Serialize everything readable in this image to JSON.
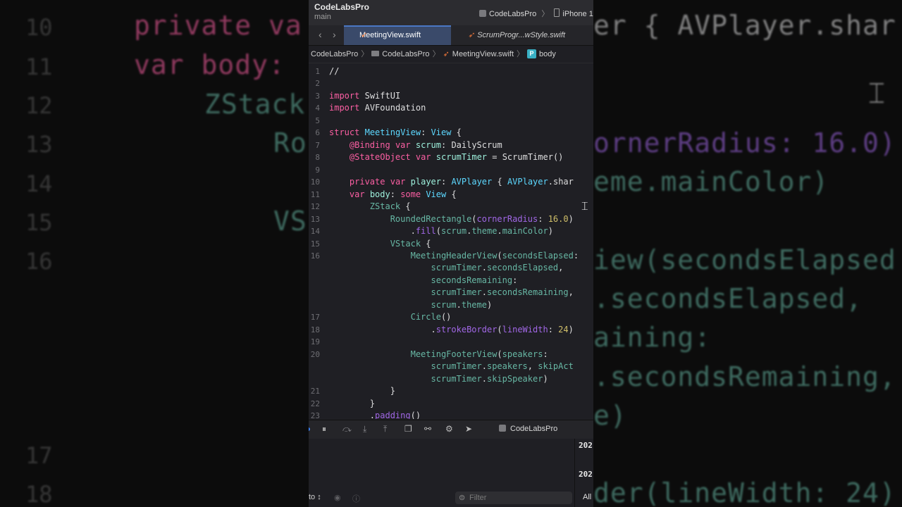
{
  "window": {
    "project": "CodeLabsPro",
    "branch": "main",
    "scheme_project": "CodeLabsPro",
    "scheme_device": "iPhone 1"
  },
  "tabs": [
    {
      "label": "MeetingView.swift",
      "active": true
    },
    {
      "label": "ScrumProgr...wStyle.swift",
      "active": false
    }
  ],
  "breadcrumb": [
    "CodeLabsPro",
    "CodeLabsPro",
    "MeetingView.swift",
    "body"
  ],
  "editor": {
    "lines": [
      {
        "n": "1",
        "text": "//"
      },
      {
        "n": "2",
        "text": ""
      },
      {
        "n": "3",
        "text": "import SwiftUI"
      },
      {
        "n": "4",
        "text": "import AVFoundation"
      },
      {
        "n": "5",
        "text": ""
      },
      {
        "n": "6",
        "text": "struct MeetingView: View {"
      },
      {
        "n": "7",
        "text": "    @Binding var scrum: DailyScrum"
      },
      {
        "n": "8",
        "text": "    @StateObject var scrumTimer = ScrumTimer()"
      },
      {
        "n": "9",
        "text": ""
      },
      {
        "n": "10",
        "text": "    private var player: AVPlayer { AVPlayer.shar"
      },
      {
        "n": "11",
        "text": "    var body: some View {"
      },
      {
        "n": "12",
        "text": "        ZStack {"
      },
      {
        "n": "13",
        "text": "            RoundedRectangle(cornerRadius: 16.0)"
      },
      {
        "n": "14",
        "text": "                .fill(scrum.theme.mainColor)"
      },
      {
        "n": "15",
        "text": "            VStack {"
      },
      {
        "n": "16",
        "text": "                MeetingHeaderView(secondsElapsed:"
      },
      {
        "n": "",
        "text": "                    scrumTimer.secondsElapsed,"
      },
      {
        "n": "",
        "text": "                    secondsRemaining:"
      },
      {
        "n": "",
        "text": "                    scrumTimer.secondsRemaining,"
      },
      {
        "n": "",
        "text": "                    scrum.theme)"
      },
      {
        "n": "17",
        "text": "                Circle()"
      },
      {
        "n": "18",
        "text": "                    .strokeBorder(lineWidth: 24)"
      },
      {
        "n": "19",
        "text": ""
      },
      {
        "n": "20",
        "text": "                MeetingFooterView(speakers:"
      },
      {
        "n": "",
        "text": "                    scrumTimer.speakers, skipAct:"
      },
      {
        "n": "",
        "text": "                    scrumTimer.skipSpeaker)"
      },
      {
        "n": "21",
        "text": "            }"
      },
      {
        "n": "22",
        "text": "        }"
      },
      {
        "n": "23",
        "text": "        .padding()"
      }
    ]
  },
  "debug": {
    "project": "CodeLabsPro",
    "log_lines": [
      "202",
      "202"
    ]
  },
  "console": {
    "auto_label": "to ↕",
    "filter_placeholder": "Filter",
    "all_label": "All"
  },
  "background": {
    "left_numbers": [
      "10",
      "11",
      "12",
      "13",
      "14",
      "15",
      "16",
      "17",
      "18"
    ],
    "left_lines": [
      "private va",
      "var body: ",
      "ZStack",
      "Ro",
      "VS"
    ],
    "right_lines": [
      "er { AVPlayer.shar",
      "ornerRadius: 16.0)",
      "eme.mainColor)",
      "iew(secondsElapsed",
      ".secondsElapsed,",
      "aining:",
      ".secondsRemaining,",
      "e)",
      "der(lineWidth: 24)"
    ]
  }
}
